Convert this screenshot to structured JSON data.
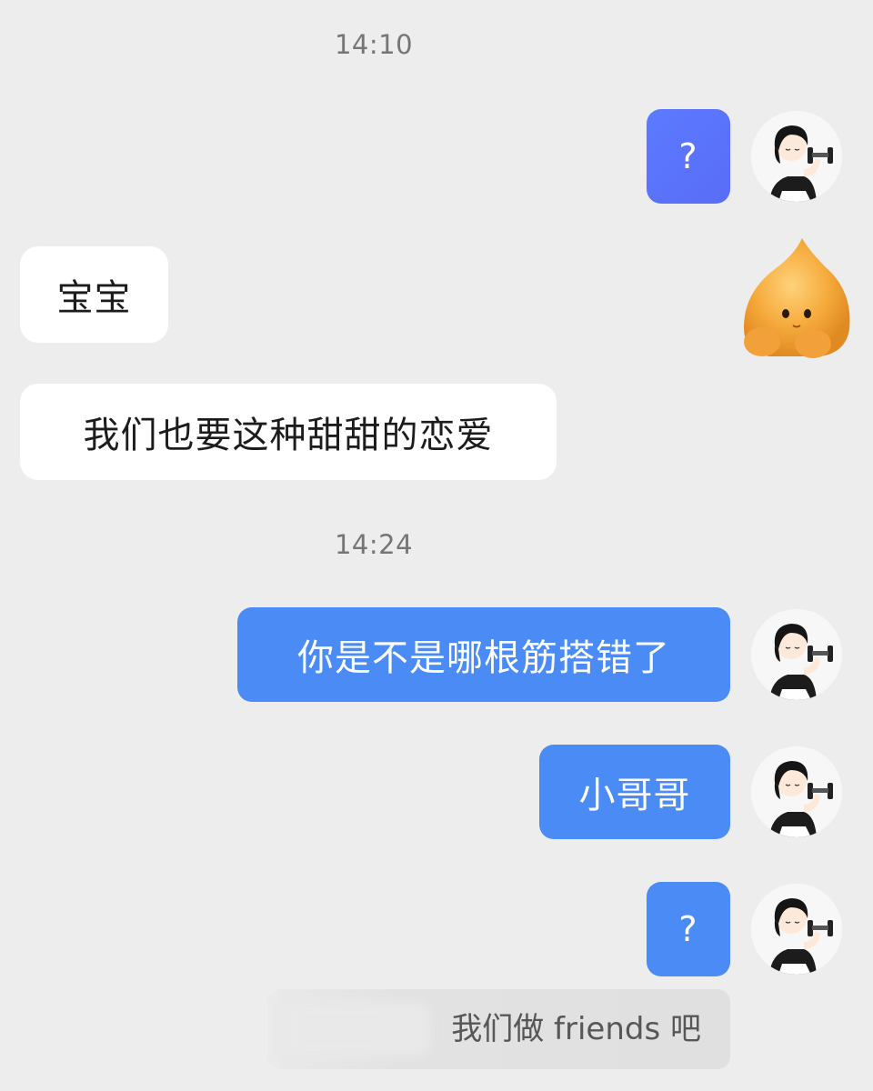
{
  "conversation": {
    "timestamps": [
      "14:10",
      "14:24"
    ],
    "messages": [
      {
        "direction": "outgoing",
        "text": "?"
      },
      {
        "direction": "incoming",
        "text": "宝宝"
      },
      {
        "direction": "incoming",
        "text": "我们也要这种甜甜的恋爱"
      },
      {
        "direction": "outgoing",
        "text": "你是不是哪根筋搭错了"
      },
      {
        "direction": "outgoing",
        "text": "小哥哥"
      },
      {
        "direction": "outgoing",
        "text": "?"
      }
    ],
    "quote": {
      "text": "我们做 friends 吧"
    }
  },
  "icons": {
    "self_avatar": "girl-with-dumbbell-avatar-icon",
    "contact_avatar": "orange-blob-avatar-icon"
  },
  "colors": {
    "background": "#ededed",
    "outgoing_bubble": "#4a8bf5",
    "outgoing_bubble_violet": "#5b7bff",
    "incoming_bubble": "#ffffff",
    "contact_avatar": "#f2a435"
  }
}
